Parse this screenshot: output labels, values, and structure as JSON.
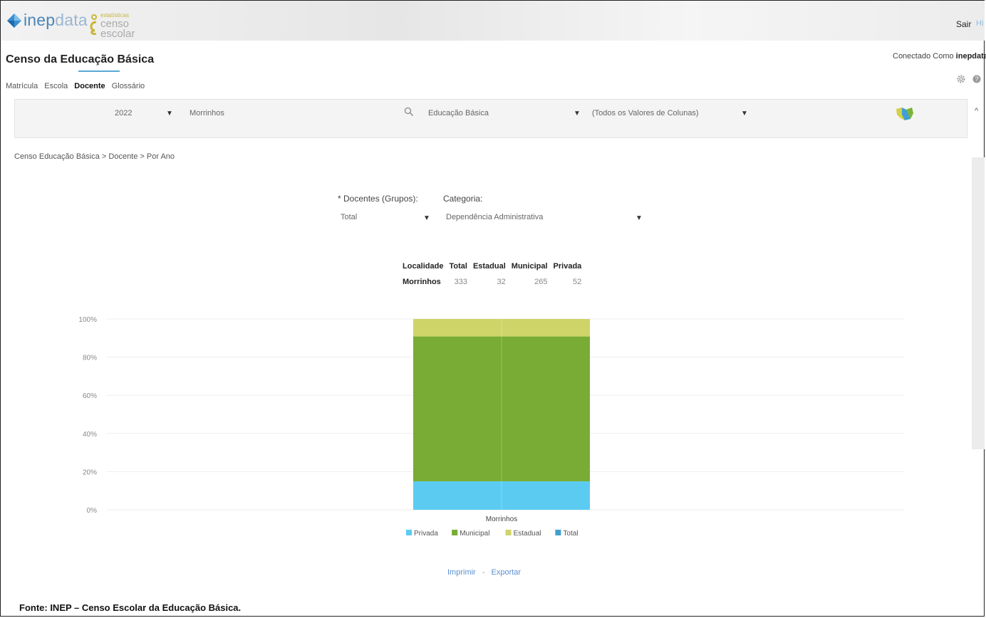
{
  "header": {
    "logo_text_main": "inep",
    "logo_text_thin": "data",
    "logo2_small": "estatísticas",
    "logo2_line1": "censo",
    "logo2_line2": "escolar",
    "logout_label": "Sair",
    "logout_hint": "Hi",
    "page_title": "Censo da Educação Básica",
    "connected_label": "Conectado Como",
    "connected_user": "inepdata"
  },
  "tabs": [
    {
      "label": "Matrícula",
      "active": false
    },
    {
      "label": "Escola",
      "active": false
    },
    {
      "label": "Docente",
      "active": true
    },
    {
      "label": "Glossário",
      "active": false
    }
  ],
  "filters": {
    "year": "2022",
    "municipality": "Morrinhos",
    "stage": "Educação Básica",
    "columns": "(Todos os Valores de Colunas)"
  },
  "breadcrumb": "Censo Educação Básica > Docente > Por Ano",
  "selectors": {
    "group_label": "* Docentes (Grupos):",
    "group_value": "Total",
    "category_label": "Categoria:",
    "category_value": "Dependência Administrativa"
  },
  "table": {
    "headers": [
      "Localidade",
      "Total",
      "Estadual",
      "Municipal",
      "Privada"
    ],
    "row": [
      "Morrinhos",
      "333",
      "32",
      "265",
      "52"
    ]
  },
  "chart_data": {
    "type": "bar",
    "stacked": true,
    "percent": true,
    "categories": [
      "Morrinhos"
    ],
    "series": [
      {
        "name": "Privada",
        "values": [
          52
        ],
        "color": "#5ccbf2"
      },
      {
        "name": "Municipal",
        "values": [
          265
        ],
        "color": "#78ac34"
      },
      {
        "name": "Estadual",
        "values": [
          32
        ],
        "color": "#cfd468"
      },
      {
        "name": "Total",
        "values": [
          333
        ],
        "color": "#3fa0d0"
      }
    ],
    "stack_order": [
      "Privada",
      "Municipal",
      "Estadual"
    ],
    "y_ticks": [
      "0%",
      "20%",
      "40%",
      "60%",
      "80%",
      "100%"
    ],
    "ylim": [
      0,
      100
    ],
    "grid": true,
    "legend_position": "bottom"
  },
  "actions": {
    "print": "Imprimir",
    "export": "Exportar"
  },
  "footer": "Fonte: INEP – Censo Escolar da Educação Básica."
}
